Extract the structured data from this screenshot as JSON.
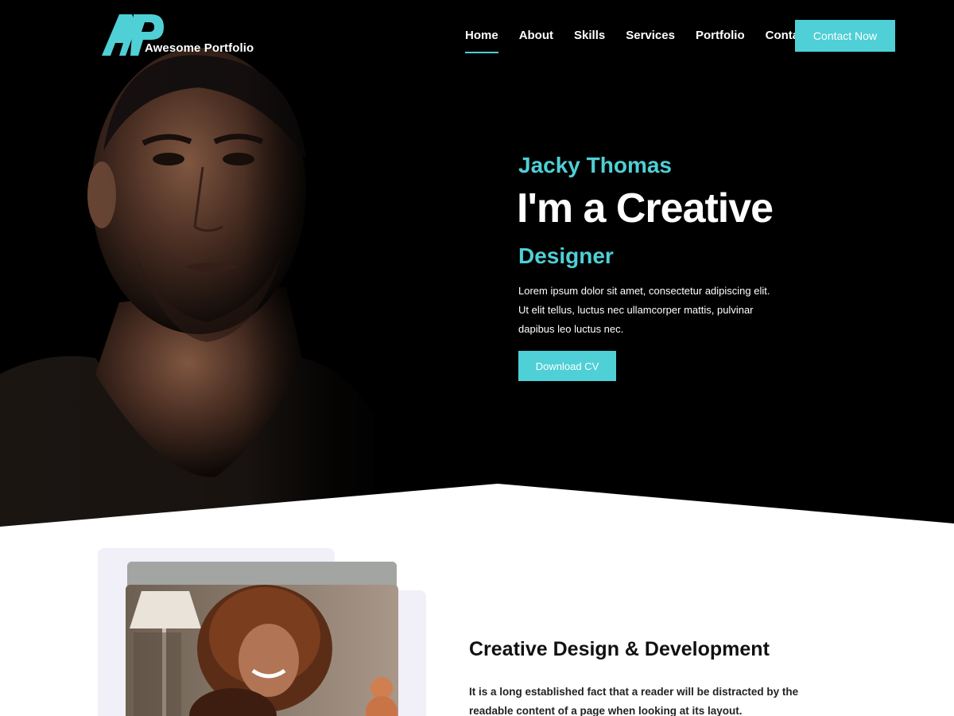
{
  "brand": {
    "logo_mark": "AP",
    "logo_text": "Awesome Portfolio",
    "accent_color": "#4fcfd6"
  },
  "nav": {
    "items": [
      {
        "label": "Home",
        "active": true
      },
      {
        "label": "About"
      },
      {
        "label": "Skills"
      },
      {
        "label": "Services"
      },
      {
        "label": "Portfolio"
      },
      {
        "label": "Contact"
      }
    ],
    "contact_button": "Contact Now"
  },
  "hero": {
    "name": "Jacky Thomas",
    "title": "I'm a Creative",
    "role": "Designer",
    "description_lines": [
      "Lorem ipsum dolor sit amet, consectetur adipiscing elit.",
      "Ut elit tellus, luctus nec ullamcorper mattis, pulvinar",
      "dapibus leo luctus nec."
    ],
    "cta": "Download CV"
  },
  "about": {
    "title": "Creative Design & Development",
    "text_lines": [
      "It is a long established fact that a reader will be distracted by the",
      "readable content of a page when looking at its layout."
    ]
  }
}
